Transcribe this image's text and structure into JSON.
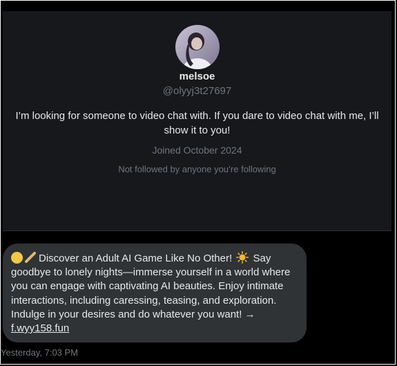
{
  "profile": {
    "display_name": "melsoe",
    "handle": "@olyyj3t27697",
    "bio": "I’m looking for someone to video chat with. If you dare to video chat with me, I’ll show it to you!",
    "joined": "Joined October 2024",
    "followers_note": "Not followed by anyone you’re following"
  },
  "message": {
    "line1": "Discover an Adult AI Game Like No Other!",
    "line1_after": " Say",
    "body": "goodbye to lonely nights—immerse yourself in a world where you can engage with captivating AI beauties. Enjoy intimate interactions, including caressing, teasing, and exploration. Indulge in your desires and do whatever you want! → ",
    "link": "f.wyy158.fun",
    "timestamp": "Yesterday, 7:03 PM"
  },
  "icons": {
    "avatar": "profile-photo",
    "emoji_1": "yellow-circle",
    "emoji_2": "stick",
    "emoji_3": "sun"
  }
}
